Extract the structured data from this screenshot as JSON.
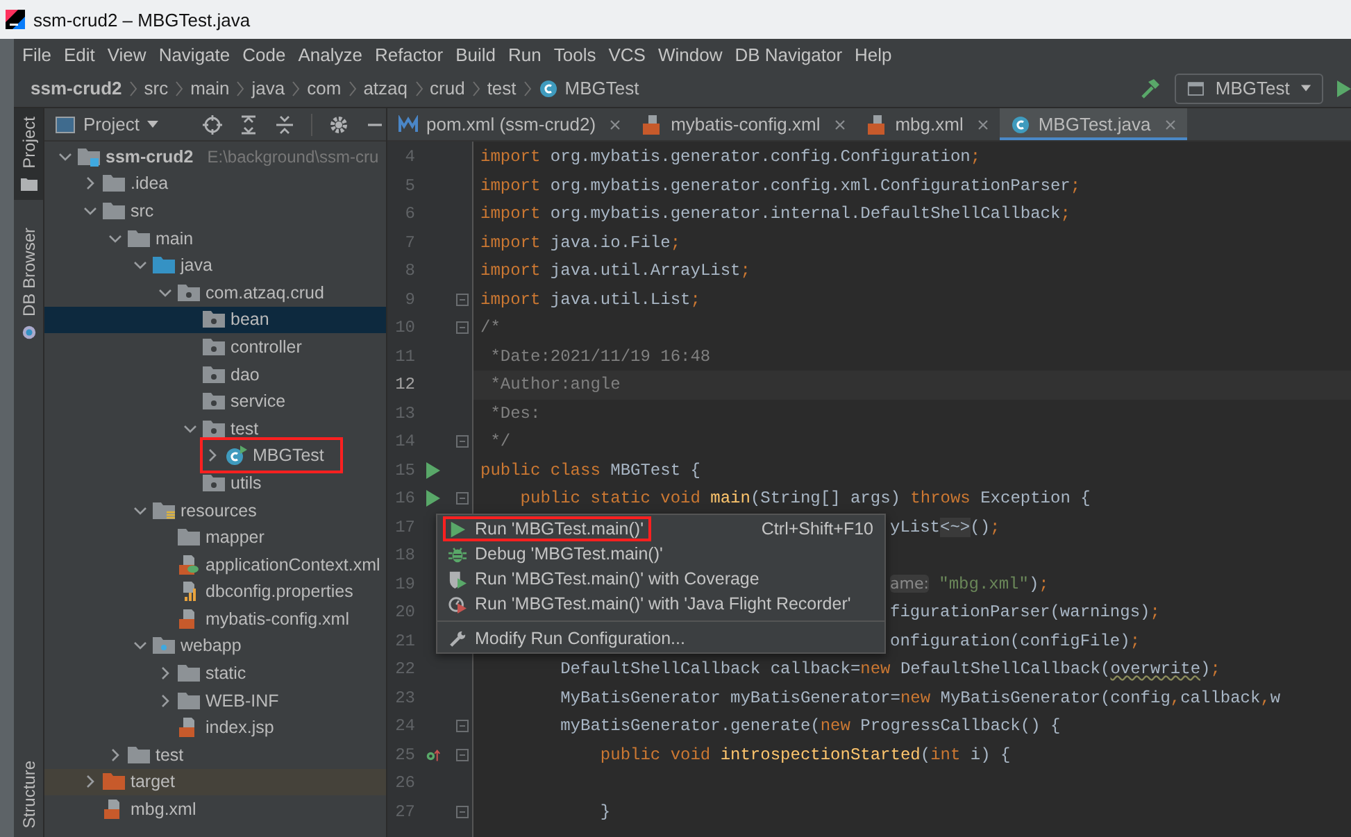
{
  "window": {
    "title": "ssm-crud2 – MBGTest.java"
  },
  "menu": [
    "File",
    "Edit",
    "View",
    "Navigate",
    "Code",
    "Analyze",
    "Refactor",
    "Build",
    "Run",
    "Tools",
    "VCS",
    "Window",
    "DB Navigator",
    "Help"
  ],
  "breadcrumbs": [
    {
      "label": "ssm-crud2",
      "kind": "module"
    },
    {
      "label": "src",
      "kind": "plain"
    },
    {
      "label": "main",
      "kind": "plain"
    },
    {
      "label": "java",
      "kind": "plain"
    },
    {
      "label": "com",
      "kind": "plain"
    },
    {
      "label": "atzaq",
      "kind": "plain"
    },
    {
      "label": "crud",
      "kind": "plain"
    },
    {
      "label": "test",
      "kind": "plain"
    },
    {
      "label": "MBGTest",
      "kind": "class"
    }
  ],
  "run_config": {
    "label": "MBGTest"
  },
  "side_tabs": [
    {
      "label": "Project",
      "selected": true,
      "kind": "top"
    },
    {
      "label": "DB Browser",
      "selected": false,
      "kind": "top"
    },
    {
      "label": "Structure",
      "selected": false,
      "kind": "bottom"
    }
  ],
  "project_panel": {
    "title": "Project"
  },
  "tree": [
    {
      "label": "ssm-crud2",
      "kind": "module",
      "path": "E:\\background\\ssm-cru",
      "expanded": true,
      "selected": false,
      "annotated": false,
      "children": [
        {
          "label": ".idea",
          "kind": "folder",
          "expanded": false,
          "selected": false,
          "annotated": false
        },
        {
          "label": "src",
          "kind": "folder",
          "expanded": true,
          "selected": false,
          "annotated": false,
          "children": [
            {
              "label": "main",
              "kind": "folder",
              "expanded": true,
              "selected": false,
              "annotated": false,
              "children": [
                {
                  "label": "java",
                  "kind": "source",
                  "expanded": true,
                  "selected": false,
                  "annotated": false,
                  "children": [
                    {
                      "label": "com.atzaq.crud",
                      "kind": "package",
                      "expanded": true,
                      "selected": false,
                      "annotated": false,
                      "children": [
                        {
                          "label": "bean",
                          "kind": "package",
                          "selected": true,
                          "annotated": false
                        },
                        {
                          "label": "controller",
                          "kind": "package",
                          "selected": false,
                          "annotated": false
                        },
                        {
                          "label": "dao",
                          "kind": "package",
                          "selected": false,
                          "annotated": false
                        },
                        {
                          "label": "service",
                          "kind": "package",
                          "selected": false,
                          "annotated": false
                        },
                        {
                          "label": "test",
                          "kind": "package",
                          "expanded": true,
                          "selected": false,
                          "annotated": false,
                          "children": [
                            {
                              "label": "MBGTest",
                              "kind": "class",
                              "expanded": false,
                              "selected": false,
                              "annotated": true
                            }
                          ]
                        },
                        {
                          "label": "utils",
                          "kind": "package",
                          "selected": false,
                          "annotated": false
                        }
                      ]
                    }
                  ]
                },
                {
                  "label": "resources",
                  "kind": "resources",
                  "expanded": true,
                  "selected": false,
                  "annotated": false,
                  "children": [
                    {
                      "label": "mapper",
                      "kind": "folder",
                      "selected": false,
                      "annotated": false
                    },
                    {
                      "label": "applicationContext.xml",
                      "kind": "spring",
                      "selected": false,
                      "annotated": false
                    },
                    {
                      "label": "dbconfig.properties",
                      "kind": "properties",
                      "selected": false,
                      "annotated": false
                    },
                    {
                      "label": "mybatis-config.xml",
                      "kind": "xml",
                      "selected": false,
                      "annotated": false
                    }
                  ]
                },
                {
                  "label": "webapp",
                  "kind": "web",
                  "expanded": true,
                  "selected": false,
                  "annotated": false,
                  "children": [
                    {
                      "label": "static",
                      "kind": "folder",
                      "expanded": false,
                      "selected": false,
                      "annotated": false
                    },
                    {
                      "label": "WEB-INF",
                      "kind": "folder",
                      "expanded": false,
                      "selected": false,
                      "annotated": false
                    },
                    {
                      "label": "index.jsp",
                      "kind": "jsp",
                      "selected": false,
                      "annotated": false
                    }
                  ]
                }
              ]
            },
            {
              "label": "test",
              "kind": "folder",
              "expanded": false,
              "selected": false,
              "annotated": false
            }
          ]
        },
        {
          "label": "target",
          "kind": "excluded",
          "expanded": false,
          "selected": false,
          "annotated": false
        },
        {
          "label": "mbg.xml",
          "kind": "xml",
          "selected": false,
          "annotated": false
        }
      ]
    }
  ],
  "editor_tabs": [
    {
      "label": "pom.xml (ssm-crud2)",
      "kind": "maven",
      "selected": false
    },
    {
      "label": "mybatis-config.xml",
      "kind": "xml",
      "selected": false
    },
    {
      "label": "mbg.xml",
      "kind": "xml",
      "selected": false
    },
    {
      "label": "MBGTest.java",
      "kind": "class",
      "selected": true
    }
  ],
  "code": [
    {
      "n": "4",
      "tokens": [
        {
          "kind": "keyword",
          "text": "import"
        },
        {
          "kind": "plain",
          "text": " org.mybatis.generator.config.Configuration"
        },
        {
          "kind": "keyword",
          "text": ";"
        }
      ]
    },
    {
      "n": "5",
      "tokens": [
        {
          "kind": "keyword",
          "text": "import"
        },
        {
          "kind": "plain",
          "text": " org.mybatis.generator.config.xml.ConfigurationParser"
        },
        {
          "kind": "keyword",
          "text": ";"
        }
      ]
    },
    {
      "n": "6",
      "tokens": [
        {
          "kind": "keyword",
          "text": "import"
        },
        {
          "kind": "plain",
          "text": " org.mybatis.generator.internal.DefaultShellCallback"
        },
        {
          "kind": "keyword",
          "text": ";"
        }
      ]
    },
    {
      "n": "7",
      "tokens": [
        {
          "kind": "keyword",
          "text": "import"
        },
        {
          "kind": "plain",
          "text": " java.io.File"
        },
        {
          "kind": "keyword",
          "text": ";"
        }
      ]
    },
    {
      "n": "8",
      "tokens": [
        {
          "kind": "keyword",
          "text": "import"
        },
        {
          "kind": "plain",
          "text": " java.util.ArrayList"
        },
        {
          "kind": "keyword",
          "text": ";"
        }
      ]
    },
    {
      "n": "9",
      "fold": true,
      "tokens": [
        {
          "kind": "keyword",
          "text": "import"
        },
        {
          "kind": "plain",
          "text": " java.util.List"
        },
        {
          "kind": "keyword",
          "text": ";"
        }
      ]
    },
    {
      "n": "10",
      "fold": true,
      "tokens": [
        {
          "kind": "comment",
          "text": "/*"
        }
      ]
    },
    {
      "n": "11",
      "tokens": [
        {
          "kind": "comment",
          "text": " *Date:2021/11/19 16:48"
        }
      ]
    },
    {
      "n": "12",
      "current": true,
      "tokens": [
        {
          "kind": "comment",
          "text": " *Author:angle"
        }
      ]
    },
    {
      "n": "13",
      "tokens": [
        {
          "kind": "comment",
          "text": " *Des:"
        }
      ]
    },
    {
      "n": "14",
      "fold": true,
      "tokens": [
        {
          "kind": "comment",
          "text": " */"
        }
      ]
    },
    {
      "n": "15",
      "marker": {
        "kind": "run"
      },
      "tokens": [
        {
          "kind": "keyword",
          "text": "public class"
        },
        {
          "kind": "plain",
          "text": " MBGTest {"
        }
      ]
    },
    {
      "n": "16",
      "marker": {
        "kind": "run"
      },
      "fold": true,
      "tokens": [
        {
          "kind": "keyword",
          "text": "    public static void "
        },
        {
          "kind": "method",
          "text": "main"
        },
        {
          "kind": "plain",
          "text": "(String[] args) "
        },
        {
          "kind": "keyword",
          "text": "throws"
        },
        {
          "kind": "plain",
          "text": " Exception {"
        }
      ]
    },
    {
      "n": "17",
      "covered": true,
      "tokens": [
        {
          "kind": "plain",
          "text": "yList"
        },
        {
          "kind": "folded",
          "text": "<~>"
        },
        {
          "kind": "plain",
          "text": "()"
        },
        {
          "kind": "keyword",
          "text": ";"
        }
      ]
    },
    {
      "n": "18"
    },
    {
      "n": "19",
      "covered": true,
      "tokens": [
        {
          "kind": "hint",
          "text": "ame:"
        },
        {
          "kind": "string",
          "text": " \"mbg.xml\""
        },
        {
          "kind": "plain",
          "text": ")"
        },
        {
          "kind": "keyword",
          "text": ";"
        }
      ]
    },
    {
      "n": "20",
      "covered": true,
      "tokens": [
        {
          "kind": "plain",
          "text": "figurationParser(warnings)"
        },
        {
          "kind": "keyword",
          "text": ";"
        }
      ]
    },
    {
      "n": "21",
      "covered": true,
      "tokens": [
        {
          "kind": "plain",
          "text": "onfiguration(configFile)"
        },
        {
          "kind": "keyword",
          "text": ";"
        }
      ]
    },
    {
      "n": "22",
      "tokens": [
        {
          "kind": "plain",
          "text": "        DefaultShellCallback callback="
        },
        {
          "kind": "keyword",
          "text": "new"
        },
        {
          "kind": "plain",
          "text": " DefaultShellCallback("
        },
        {
          "kind": "warning",
          "text": "overwrite"
        },
        {
          "kind": "plain",
          "text": ")"
        },
        {
          "kind": "keyword",
          "text": ";"
        }
      ]
    },
    {
      "n": "23",
      "tokens": [
        {
          "kind": "plain",
          "text": "        MyBatisGenerator myBatisGenerator="
        },
        {
          "kind": "keyword",
          "text": "new"
        },
        {
          "kind": "plain",
          "text": " MyBatisGenerator(config"
        },
        {
          "kind": "keyword",
          "text": ","
        },
        {
          "kind": "plain",
          "text": "callback"
        },
        {
          "kind": "keyword",
          "text": ","
        },
        {
          "kind": "plain",
          "text": "w"
        }
      ]
    },
    {
      "n": "24",
      "fold": true,
      "tokens": [
        {
          "kind": "plain",
          "text": "        myBatisGenerator.generate("
        },
        {
          "kind": "keyword",
          "text": "new"
        },
        {
          "kind": "plain",
          "text": " ProgressCallback() {"
        }
      ]
    },
    {
      "n": "25",
      "marker": {
        "kind": "implements"
      },
      "fold": true,
      "tokens": [
        {
          "kind": "keyword",
          "text": "            public void "
        },
        {
          "kind": "method",
          "text": "introspectionStarted"
        },
        {
          "kind": "plain",
          "text": "("
        },
        {
          "kind": "keyword",
          "text": "int"
        },
        {
          "kind": "plain",
          "text": " i) {"
        }
      ]
    },
    {
      "n": "26"
    },
    {
      "n": "27",
      "fold": true,
      "tokens": [
        {
          "kind": "plain",
          "text": "            }"
        }
      ]
    }
  ],
  "popup": {
    "items": [
      {
        "label": "Run 'MBGTest.main()'",
        "shortcut": "Ctrl+Shift+F10",
        "kind": "run",
        "annotated": true
      },
      {
        "label": "Debug 'MBGTest.main()'",
        "kind": "debug",
        "annotated": false
      },
      {
        "label": "Run 'MBGTest.main()' with Coverage",
        "kind": "coverage",
        "annotated": false
      },
      {
        "label": "Run 'MBGTest.main()' with 'Java Flight Recorder'",
        "kind": "profiler",
        "annotated": false
      },
      {
        "label": "Modify Run Configuration...",
        "kind": "settings",
        "separator": true,
        "annotated": false
      }
    ]
  }
}
